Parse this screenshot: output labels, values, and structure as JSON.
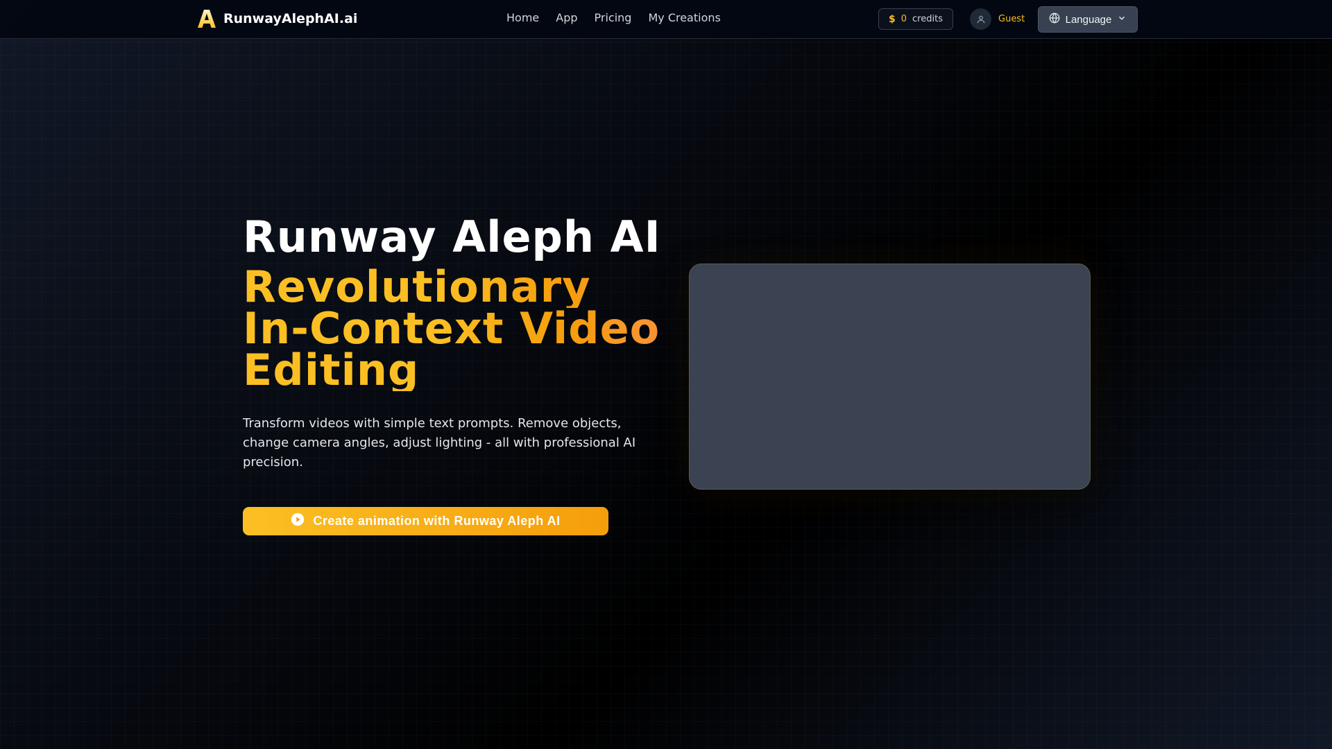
{
  "header": {
    "logo_letter": "A",
    "logo_text": "RunwayAlephAI.ai",
    "nav": [
      "Home",
      "App",
      "Pricing",
      "My Creations"
    ],
    "credits": {
      "symbol": "$",
      "count": "0",
      "label": "credits"
    },
    "user": {
      "name": "Guest",
      "icon": "user-icon"
    },
    "language": {
      "label": "Language",
      "icon": "globe-icon",
      "caret": "chevron-down-icon"
    }
  },
  "hero": {
    "title": "Runway Aleph AI",
    "subtitle_lines": [
      "Revolutionary",
      "In-Context Video",
      "Editing"
    ],
    "description": "Transform videos with simple text prompts. Remove objects, change camera angles, adjust lighting - all with professional AI precision.",
    "cta_label": "Create animation with Runway Aleph AI",
    "cta_icon": "play-circle-icon"
  },
  "colors": {
    "accent": "#fbbf24",
    "accent_end": "#fb923c",
    "header_bg": "#030712",
    "card_bg": "#3b4352"
  }
}
